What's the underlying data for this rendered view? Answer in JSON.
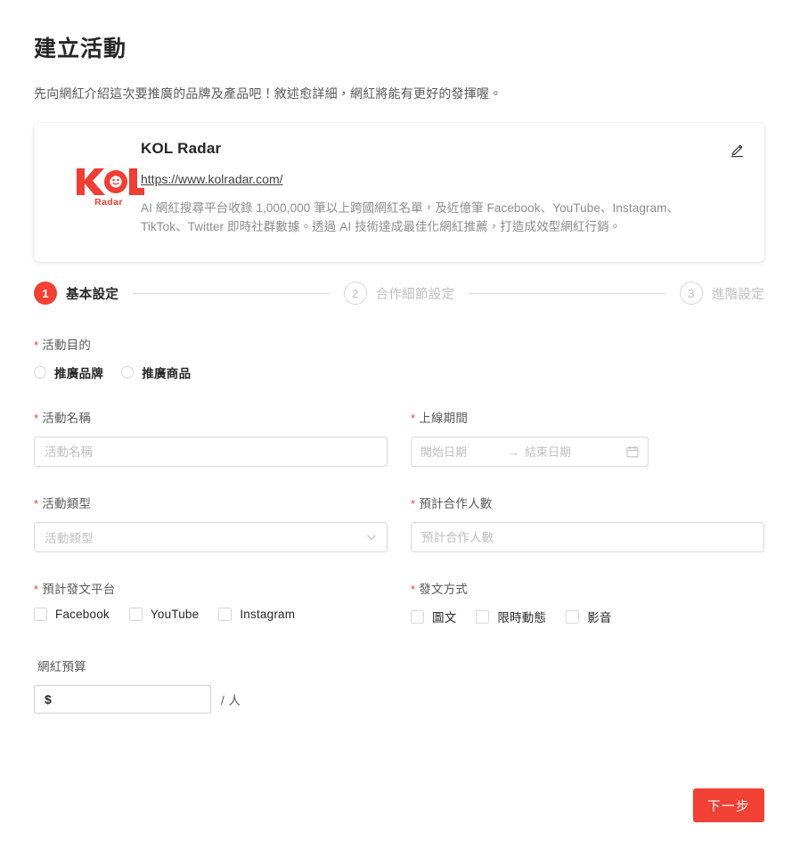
{
  "header": {
    "title": "建立活動",
    "subtitle": "先向網紅介紹這次要推廣的品牌及產品吧！敘述愈詳細，網紅將能有更好的發揮喔。"
  },
  "brand_card": {
    "logo_main": "KOL",
    "logo_sub": "Radar",
    "name": "KOL Radar",
    "url": "https://www.kolradar.com/",
    "description": "AI 網紅搜尋平台收錄 1,000,000 筆以上跨國網紅名單，及近億筆 Facebook、YouTube、Instagram、TikTok、Twitter 即時社群數據。透過 AI 技術達成最佳化網紅推薦，打造成效型網紅行銷。",
    "edit_icon": "pencil-edit-icon"
  },
  "steps": [
    {
      "number": "1",
      "label": "基本設定",
      "state": "active"
    },
    {
      "number": "2",
      "label": "合作細節設定",
      "state": "inactive"
    },
    {
      "number": "3",
      "label": "進階設定",
      "state": "inactive"
    }
  ],
  "form": {
    "purpose": {
      "label": "活動目的",
      "required": "*",
      "options": [
        {
          "label": "推廣品牌",
          "checked": false
        },
        {
          "label": "推廣商品",
          "checked": false
        }
      ]
    },
    "campaign_name": {
      "label": "活動名稱",
      "required": "*",
      "placeholder": "活動名稱",
      "value": ""
    },
    "online_period": {
      "label": "上線期間",
      "required": "*",
      "start_placeholder": "開始日期",
      "end_placeholder": "結束日期",
      "separator": "→",
      "start_value": "",
      "end_value": "",
      "calendar_icon": "calendar-icon"
    },
    "campaign_type": {
      "label": "活動類型",
      "required": "*",
      "placeholder": "活動類型",
      "value": "",
      "arrow_icon": "chevron-down-icon"
    },
    "expected_people": {
      "label": "預計合作人數",
      "required": "*",
      "placeholder": "預計合作人數",
      "value": ""
    },
    "platforms": {
      "label": "預計發文平台",
      "required": "*",
      "options": [
        {
          "label": "Facebook",
          "checked": false
        },
        {
          "label": "YouTube",
          "checked": false
        },
        {
          "label": "Instagram",
          "checked": false
        }
      ]
    },
    "post_types": {
      "label": "發文方式",
      "required": "*",
      "options": [
        {
          "label": "圖文",
          "checked": false
        },
        {
          "label": "限時動態",
          "checked": false
        },
        {
          "label": "影音",
          "checked": false
        }
      ]
    },
    "budget": {
      "label": "網紅預算",
      "required": "",
      "value": "$",
      "unit": "/ 人"
    }
  },
  "footer": {
    "next_label": "下一步"
  },
  "colors": {
    "accent": "#f04134",
    "text_primary": "#262626",
    "text_secondary": "#595959",
    "text_muted": "#bfbfbf",
    "border": "#d9d9d9"
  }
}
